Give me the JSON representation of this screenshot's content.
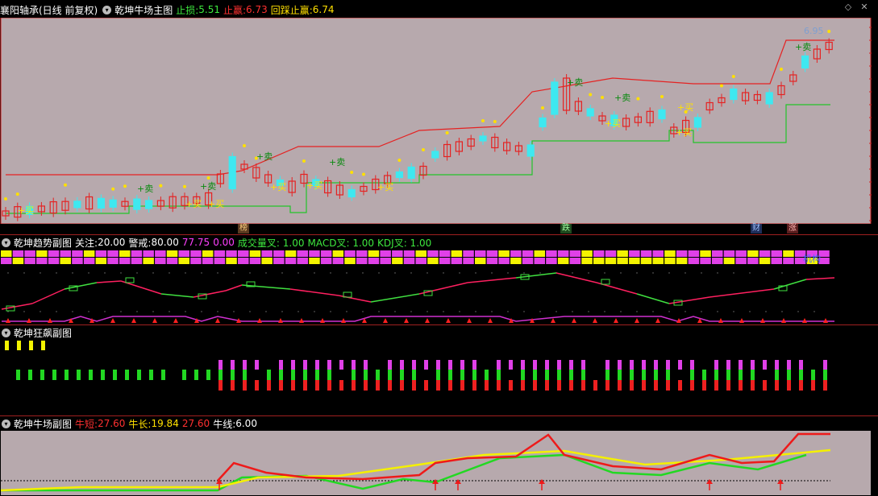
{
  "header": {
    "stock": "襄阳轴承(日线 前复权)",
    "indicator": "乾坤牛场主图",
    "stop_loss_label": "止损:",
    "stop_loss_value": "5.51",
    "take_profit_label": "止赢:",
    "take_profit_value": "6.73",
    "pullback_label": "回踩止赢:",
    "pullback_value": "6.74",
    "icons": [
      "diamond-icon",
      "close-icon"
    ]
  },
  "main_chart": {
    "price_label": "6.95",
    "buy_label": "+买",
    "sell_label": "+卖",
    "bottom_tags": [
      "榜",
      "跌",
      "财",
      "涨"
    ]
  },
  "trend_panel": {
    "title": "乾坤趋势副图",
    "focus_label": "关注:",
    "focus_value": "20.00",
    "alert_label": "警戒:",
    "alert_value": "80.00",
    "v1": "77.75",
    "v2": "0.00",
    "vol_cross": "成交量叉: 1.00",
    "macd_cross": "MACD叉: 1.00",
    "kdj_cross": "KDJ叉: 1.00",
    "tag": "机构"
  },
  "surge_panel": {
    "title": "乾坤狂飙副图"
  },
  "bull_panel": {
    "title": "乾坤牛场副图",
    "short_label": "牛短:",
    "short_value": "27.60",
    "long_label": "牛长:",
    "long_value": "19.84",
    "v3": "27.60",
    "line_label": "牛线:",
    "line_value": "6.00"
  },
  "colors": {
    "main_bg": "#b7a9ad",
    "up": "#e52222",
    "down": "#3ee8f0",
    "support": "#22c42a",
    "dots": "#ffe000"
  }
}
